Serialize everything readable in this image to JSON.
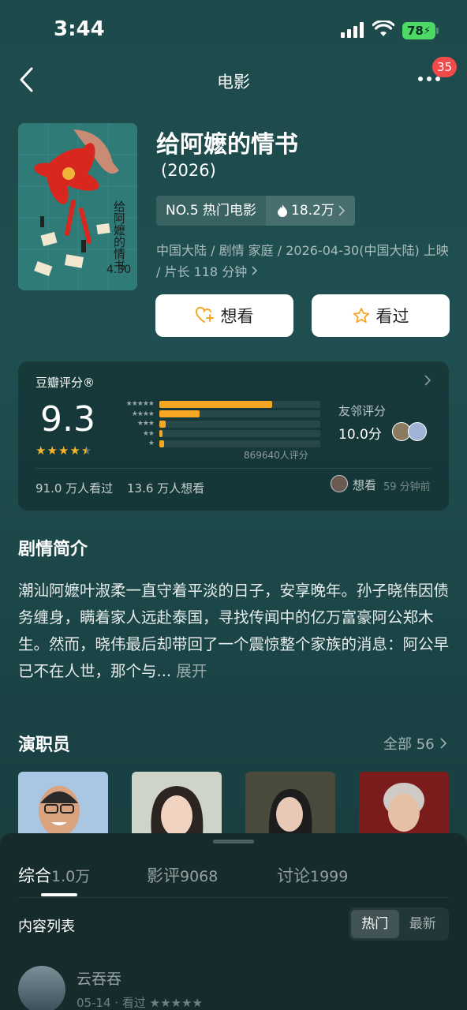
{
  "status_bar": {
    "time": "3:44",
    "battery": "78"
  },
  "nav": {
    "title": "电影",
    "badge": "35"
  },
  "movie": {
    "title": "给阿嬷的情书",
    "year": "(2026)",
    "rank": "NO.5 热门电影",
    "heat": "18.2万",
    "meta": "中国大陆 / 剧情 家庭 / 2026-04-30(中国大陆) 上映 / 片长 118 分钟",
    "poster_date": "4.30",
    "poster_title": "给阿嬷的情书"
  },
  "actions": {
    "want": "想看",
    "seen": "看过"
  },
  "rating": {
    "brand": "豆瓣评分®",
    "score": "9.3",
    "distribution": [
      {
        "stars": "★★★★★",
        "fraction": 0.7
      },
      {
        "stars": "★★★★",
        "fraction": 0.25
      },
      {
        "stars": "★★★",
        "fraction": 0.04
      },
      {
        "stars": "★★",
        "fraction": 0.02
      },
      {
        "stars": "★",
        "fraction": 0.03
      }
    ],
    "count_text": "869640人评分",
    "friend_label": "友邻评分",
    "friend_score": "10.0分",
    "watched": "91.0 万人看过",
    "want": "13.6 万人想看",
    "activity": "想看",
    "activity_time": "59 分钟前",
    "star_color": "#f7b32c"
  },
  "synopsis": {
    "title": "剧情简介",
    "text": "潮汕阿嬷叶淑柔一直守着平淡的日子，安享晚年。孙子晓伟因债务缠身，瞒着家人远赴泰国，寻找传闻中的亿万富豪阿公郑木生。然而，晓伟最后却带回了一个震惊整个家族的消息：阿公早已不在人世，那个与...",
    "expand": "展开"
  },
  "cast": {
    "title": "演职员",
    "all": "全部 56"
  },
  "sheet": {
    "tabs": [
      {
        "label": "综合",
        "count": "1.0万"
      },
      {
        "label": "影评",
        "count": "9068"
      },
      {
        "label": "讨论",
        "count": "1999"
      }
    ],
    "list_title": "内容列表",
    "sort": [
      "热门",
      "最新"
    ],
    "review": {
      "name": "云吞吞",
      "meta": "05-14 · 看过 ★★★★★"
    }
  }
}
